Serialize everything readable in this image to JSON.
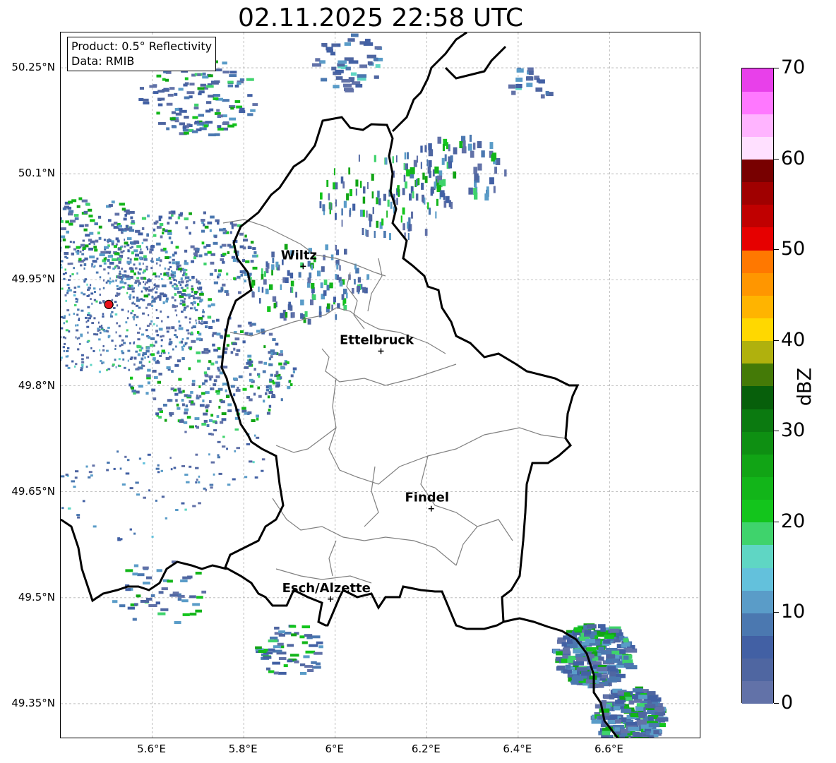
{
  "title": "02.11.2025 22:58 UTC",
  "info": {
    "product": "Product: 0.5° Reflectivity",
    "source": "Data: RMIB"
  },
  "axes": {
    "lat_ticks": [
      {
        "value": 50.25,
        "label": "50.25°N"
      },
      {
        "value": 50.1,
        "label": "50.1°N"
      },
      {
        "value": 49.95,
        "label": "49.95°N"
      },
      {
        "value": 49.8,
        "label": "49.8°N"
      },
      {
        "value": 49.65,
        "label": "49.65°N"
      },
      {
        "value": 49.5,
        "label": "49.5°N"
      },
      {
        "value": 49.35,
        "label": "49.35°N"
      }
    ],
    "lon_ticks": [
      {
        "value": 5.6,
        "label": "5.6°E"
      },
      {
        "value": 5.8,
        "label": "5.8°E"
      },
      {
        "value": 6.0,
        "label": "6°E"
      },
      {
        "value": 6.2,
        "label": "6.2°E"
      },
      {
        "value": 6.4,
        "label": "6.4°E"
      },
      {
        "value": 6.6,
        "label": "6.6°E"
      }
    ],
    "lon_range": [
      5.4,
      6.8
    ],
    "lat_range": [
      49.3,
      50.3
    ],
    "grid": true
  },
  "cities": [
    {
      "name": "Wiltz",
      "lon": 5.93,
      "lat": 49.969
    },
    {
      "name": "Ettelbruck",
      "lon": 6.1,
      "lat": 49.849
    },
    {
      "name": "Findel",
      "lon": 6.21,
      "lat": 49.626
    },
    {
      "name": "Esch/Alzette",
      "lon": 5.99,
      "lat": 49.498
    }
  ],
  "radar_site": {
    "lon": 5.505,
    "lat": 49.915,
    "color": "#e8121b"
  },
  "colorbar": {
    "unit": "dBZ",
    "min": 0,
    "max": 70,
    "tick_labels": [
      "70",
      "60",
      "50",
      "40",
      "30",
      "20",
      "10",
      "0"
    ],
    "colors": [
      "#6272a8",
      "#4f66a1",
      "#4260a4",
      "#4b78b0",
      "#5a9cc8",
      "#63c1dc",
      "#5fd6c4",
      "#3fd36c",
      "#13c51c",
      "#12b519",
      "#11a415",
      "#0e8f12",
      "#0b7a10",
      "#075f0b",
      "#447a07",
      "#b0b10d",
      "#ffd800",
      "#ffb400",
      "#ff9600",
      "#ff7800",
      "#e60000",
      "#c00000",
      "#a00000",
      "#780000",
      "#ffe0ff",
      "#ffb4ff",
      "#ff78ff",
      "#e840ea"
    ]
  }
}
